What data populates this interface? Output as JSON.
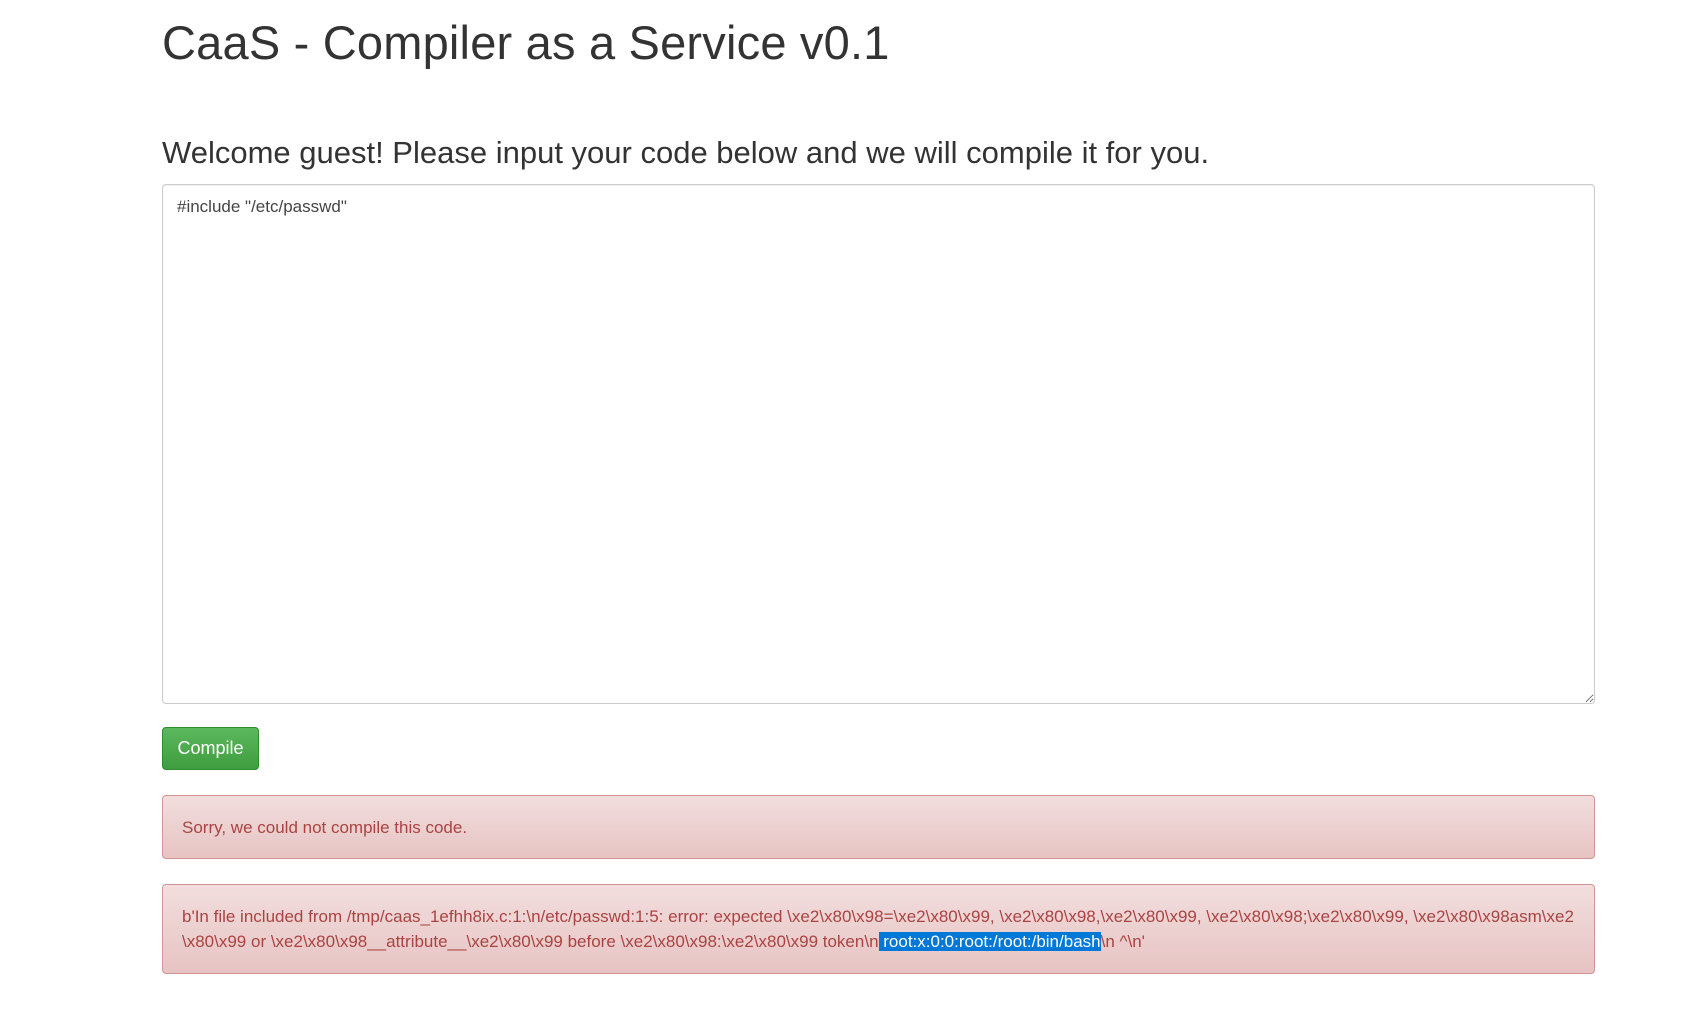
{
  "header": {
    "title": "CaaS - Compiler as a Service v0.1"
  },
  "main": {
    "welcome": "Welcome guest! Please input your code below and we will compile it for you.",
    "code_value": "#include \"/etc/passwd\"",
    "compile_label": "Compile",
    "status_message": "Sorry, we could not compile this code.",
    "error_prefix": "b'In file included from /tmp/caas_1efhh8ix.c:1:\\n/etc/passwd:1:5: error: expected \\xe2\\x80\\x98=\\xe2\\x80\\x99, \\xe2\\x80\\x98,\\xe2\\x80\\x99, \\xe2\\x80\\x98;\\xe2\\x80\\x99, \\xe2\\x80\\x98asm\\xe2\\x80\\x99 or \\xe2\\x80\\x98__attribute__\\xe2\\x80\\x99 before \\xe2\\x80\\x98:\\xe2\\x80\\x99 token\\n",
    "error_highlight": " root:x:0:0:root:/root:/bin/bash",
    "error_suffix": "\\n ^\\n'"
  },
  "colors": {
    "button": "#5cb85c",
    "alert_bg": "#f2dede",
    "alert_text": "#a94442",
    "selection": "#0078d7"
  }
}
